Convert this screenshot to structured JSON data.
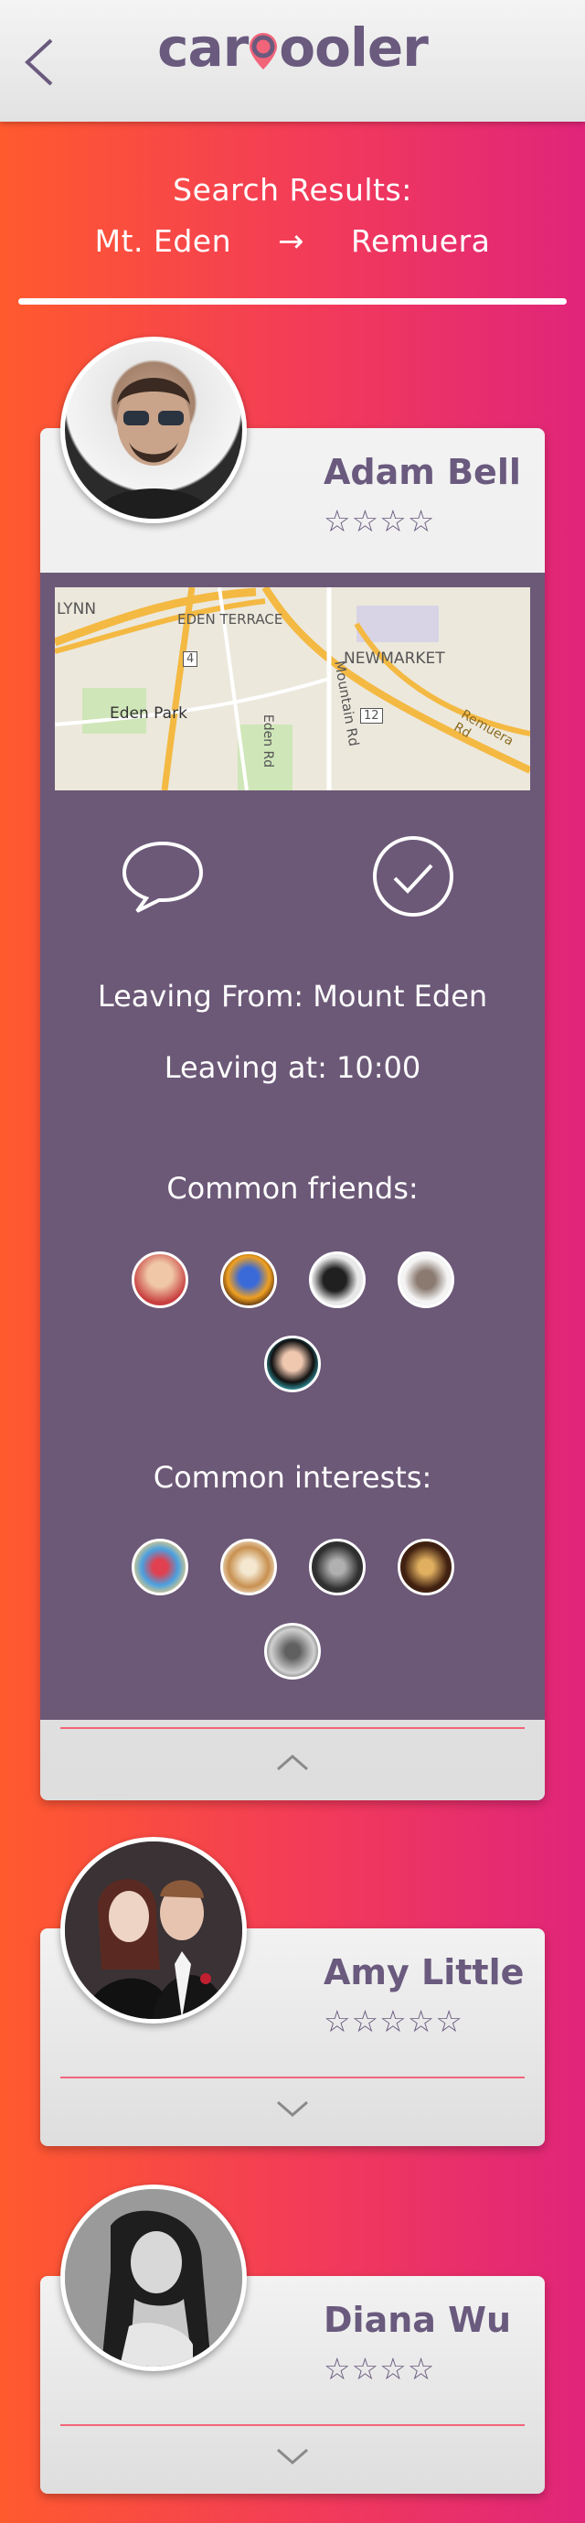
{
  "header": {
    "logo_left": "car",
    "logo_right": "ooler"
  },
  "search": {
    "label": "Search Results:",
    "from": "Mt. Eden",
    "arrow": "→",
    "to": "Remuera"
  },
  "results": [
    {
      "name": "Adam Bell",
      "rating_stars": "☆☆☆☆",
      "map_labels": [
        "LYNN",
        "EDEN TERRACE",
        "NEWMARKET",
        "Eden Park",
        "Mountain Rd",
        "Remuera Rd",
        "Eden Rd",
        "4",
        "12"
      ],
      "leaving_from": "Leaving From: Mount Eden",
      "leaving_at": "Leaving at: 10:00",
      "common_friends_label": "Common friends:",
      "common_interests_label": "Common interests:"
    },
    {
      "name": "Amy Little",
      "rating_stars": "☆☆☆☆☆"
    },
    {
      "name": "Diana Wu",
      "rating_stars": "☆☆☆☆"
    }
  ],
  "colors": {
    "panel": "#6c5877",
    "accent_text": "#6a5a7e",
    "divider_pink": "#f2647a"
  }
}
